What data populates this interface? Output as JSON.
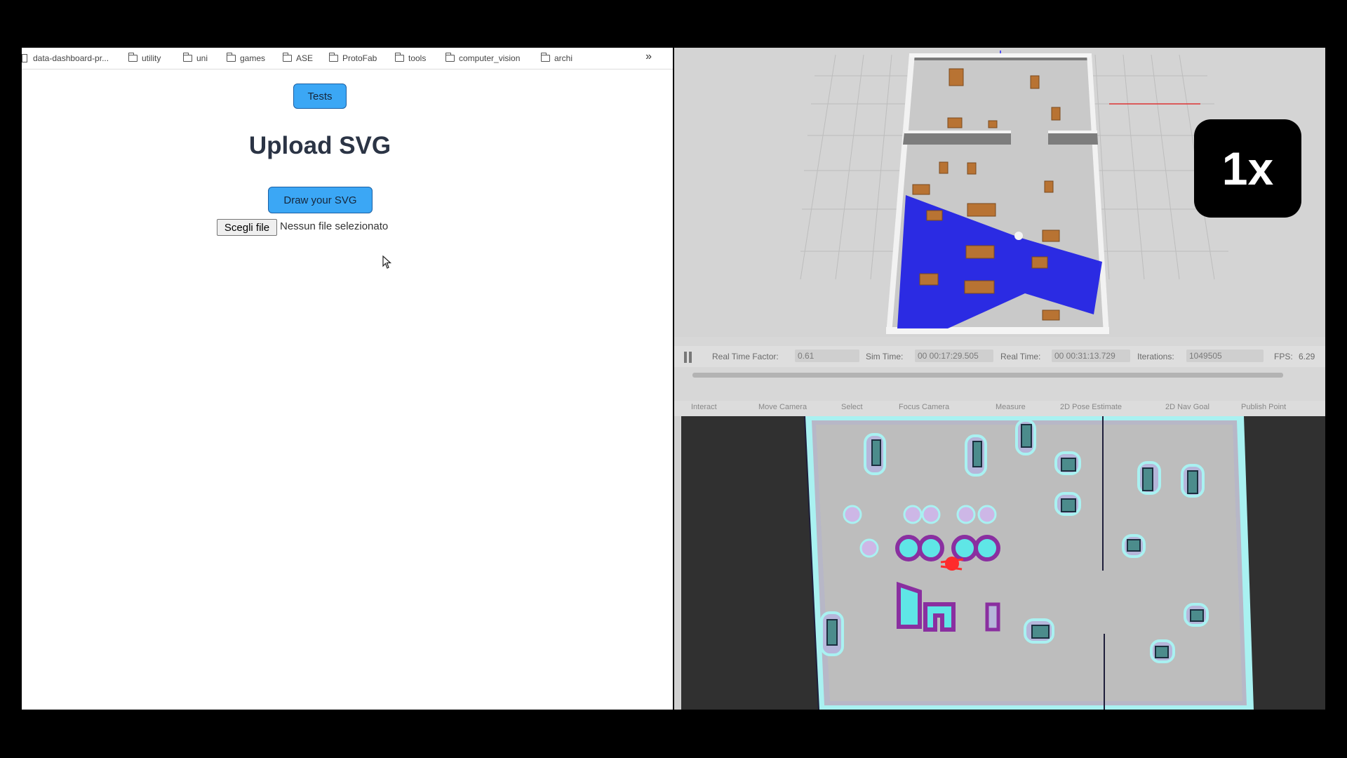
{
  "browser": {
    "bookmarks": [
      {
        "label": "data-dashboard-pr...",
        "icon": "page-icon"
      },
      {
        "label": "utility",
        "icon": "folder-icon"
      },
      {
        "label": "uni",
        "icon": "folder-icon"
      },
      {
        "label": "games",
        "icon": "folder-icon"
      },
      {
        "label": "ASE",
        "icon": "folder-icon"
      },
      {
        "label": "ProtoFab",
        "icon": "folder-icon"
      },
      {
        "label": "tools",
        "icon": "folder-icon"
      },
      {
        "label": "computer_vision",
        "icon": "folder-icon"
      },
      {
        "label": "archi",
        "icon": "folder-icon"
      }
    ],
    "more": "»",
    "tests_button": "Tests",
    "title": "Upload SVG",
    "draw_button": "Draw your SVG",
    "file_button": "Scegli file",
    "file_status": "Nessun file selezionato",
    "accent": "#3ba7f5"
  },
  "gazebo": {
    "real_time_factor_label": "Real Time Factor:",
    "real_time_factor": "0.61",
    "sim_time_label": "Sim Time:",
    "sim_time": "00 00:17:29.505",
    "real_time_label": "Real Time:",
    "real_time": "00 00:31:13.729",
    "iterations_label": "Iterations:",
    "iterations": "1049505",
    "fps_label": "FPS:",
    "fps": "6.29"
  },
  "speed_badge": "1x",
  "rviz": {
    "tools": [
      "Interact",
      "Move Camera",
      "Select",
      "Focus Camera",
      "Measure",
      "2D Pose Estimate",
      "2D Nav Goal",
      "Publish Point"
    ]
  }
}
